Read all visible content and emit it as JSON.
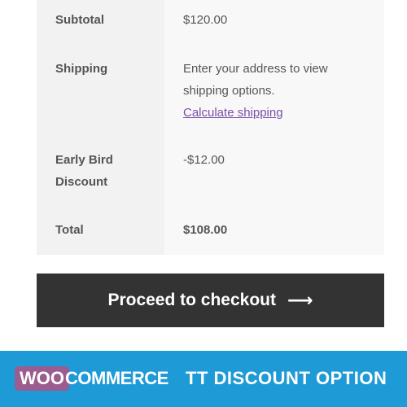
{
  "cart_totals": {
    "subtotal": {
      "label": "Subtotal",
      "value": "$120.00"
    },
    "shipping": {
      "label": "Shipping",
      "message": "Enter your address to view shipping options.",
      "link": "Calculate shipping"
    },
    "discount": {
      "label": "Early Bird Discount",
      "value": "-$12.00"
    },
    "total": {
      "label": "Total",
      "value": "$108.00"
    }
  },
  "checkout_button": {
    "label": "Proceed to checkout",
    "icon": "arrow-right-icon",
    "arrow": "⟶"
  },
  "banner": {
    "logo_woo": "WOO",
    "logo_commerce": "COMMERCE",
    "title": "TT DISCOUNT OPTION",
    "colors": {
      "background": "#1e9ad6",
      "woo_badge": "#9b5c8f"
    }
  }
}
